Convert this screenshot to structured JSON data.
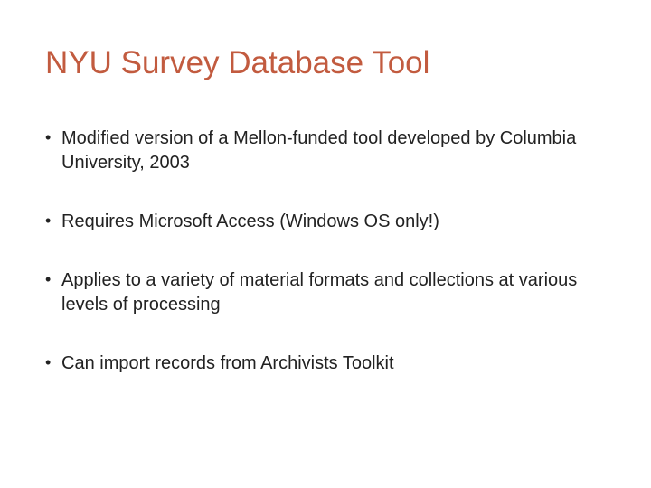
{
  "slide": {
    "title": "NYU Survey Database Tool",
    "bullets": [
      "Modified version of a Mellon-funded tool developed by Columbia University, 2003",
      "Requires Microsoft Access (Windows OS only!)",
      "Applies to a variety of material formats and collections at various levels of processing",
      "Can import records from Archivists Toolkit"
    ]
  }
}
